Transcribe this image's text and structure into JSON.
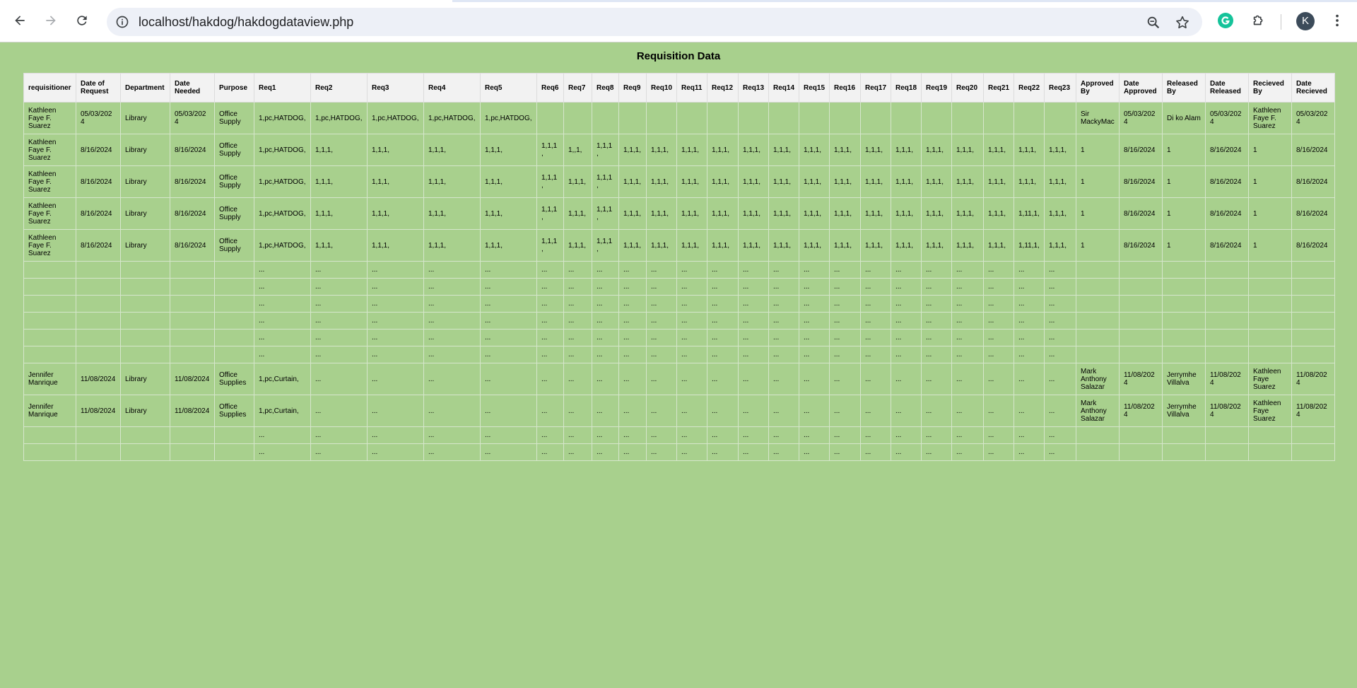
{
  "browser": {
    "url": "localhost/hakdog/hakdogdataview.php",
    "profile_initial": "K"
  },
  "page": {
    "title": "Requisition Data"
  },
  "table": {
    "headers": [
      "requisitioner",
      "Date of Request",
      "Department",
      "Date Needed",
      "Purpose",
      "Req1",
      "Req2",
      "Req3",
      "Req4",
      "Req5",
      "Req6",
      "Req7",
      "Req8",
      "Req9",
      "Req10",
      "Req11",
      "Req12",
      "Req13",
      "Req14",
      "Req15",
      "Req16",
      "Req17",
      "Req18",
      "Req19",
      "Req20",
      "Req21",
      "Req22",
      "Req23",
      "Approved By",
      "Date Approved",
      "Released By",
      "Date Released",
      "Recieved By",
      "Date Recieved"
    ],
    "rows": [
      [
        "Kathleen Faye F. Suarez",
        "05/03/2024",
        "Library",
        "05/03/2024",
        "Office Supply",
        "1,pc,HATDOG,",
        "1,pc,HATDOG,",
        "1,pc,HATDOG,",
        "1,pc,HATDOG,",
        "1,pc,HATDOG,",
        "",
        "",
        "",
        "",
        "",
        "",
        "",
        "",
        "",
        "",
        "",
        "",
        "",
        "",
        "",
        "",
        "",
        "",
        "Sir MackyMac",
        "05/03/2024",
        "Di ko Alam",
        "05/03/2024",
        "Kathleen Faye F. Suarez",
        "05/03/2024"
      ],
      [
        "Kathleen Faye F. Suarez",
        "8/16/2024",
        "Library",
        "8/16/2024",
        "Office Supply",
        "1,pc,HATDOG,",
        "1,1,1,",
        "1,1,1,",
        "1,1,1,",
        "1,1,1,",
        "1,1,1,",
        "1,,1,",
        "1,1,1,",
        "1,1,1,",
        "1,1,1,",
        "1,1,1,",
        "1,1,1,",
        "1,1,1,",
        "1,1,1,",
        "1,1,1,",
        "1,1,1,",
        "1,1,1,",
        "1,1,1,",
        "1,1,1,",
        "1,1,1,",
        "1,1,1,",
        "1,1,1,",
        "1,1,1,",
        "1",
        "8/16/2024",
        "1",
        "8/16/2024",
        "1",
        "8/16/2024"
      ],
      [
        "Kathleen Faye F. Suarez",
        "8/16/2024",
        "Library",
        "8/16/2024",
        "Office Supply",
        "1,pc,HATDOG,",
        "1,1,1,",
        "1,1,1,",
        "1,1,1,",
        "1,1,1,",
        "1,1,1,",
        "1,1,1,",
        "1,1,1,",
        "1,1,1,",
        "1,1,1,",
        "1,1,1,",
        "1,1,1,",
        "1,1,1,",
        "1,1,1,",
        "1,1,1,",
        "1,1,1,",
        "1,1,1,",
        "1,1,1,",
        "1,1,1,",
        "1,1,1,",
        "1,1,1,",
        "1,1,1,",
        "1,1,1,",
        "1",
        "8/16/2024",
        "1",
        "8/16/2024",
        "1",
        "8/16/2024"
      ],
      [
        "Kathleen Faye F. Suarez",
        "8/16/2024",
        "Library",
        "8/16/2024",
        "Office Supply",
        "1,pc,HATDOG,",
        "1,1,1,",
        "1,1,1,",
        "1,1,1,",
        "1,1,1,",
        "1,1,1,",
        "1,1,1,",
        "1,1,1,",
        "1,1,1,",
        "1,1,1,",
        "1,1,1,",
        "1,1,1,",
        "1,1,1,",
        "1,1,1,",
        "1,1,1,",
        "1,1,1,",
        "1,1,1,",
        "1,1,1,",
        "1,1,1,",
        "1,1,1,",
        "1,1,1,",
        "1,11,1,",
        "1,1,1,",
        "1",
        "8/16/2024",
        "1",
        "8/16/2024",
        "1",
        "8/16/2024"
      ],
      [
        "Kathleen Faye F. Suarez",
        "8/16/2024",
        "Library",
        "8/16/2024",
        "Office Supply",
        "1,pc,HATDOG,",
        "1,1,1,",
        "1,1,1,",
        "1,1,1,",
        "1,1,1,",
        "1,1,1,",
        "1,1,1,",
        "1,1,1,",
        "1,1,1,",
        "1,1,1,",
        "1,1,1,",
        "1,1,1,",
        "1,1,1,",
        "1,1,1,",
        "1,1,1,",
        "1,1,1,",
        "1,1,1,",
        "1,1,1,",
        "1,1,1,",
        "1,1,1,",
        "1,1,1,",
        "1,11,1,",
        "1,1,1,",
        "1",
        "8/16/2024",
        "1",
        "8/16/2024",
        "1",
        "8/16/2024"
      ],
      [
        "",
        "",
        "",
        "",
        "",
        "...",
        "...",
        "...",
        "...",
        "...",
        "...",
        "...",
        "...",
        "...",
        "...",
        "...",
        "...",
        "...",
        "...",
        "...",
        "...",
        "...",
        "...",
        "...",
        "...",
        "...",
        "...",
        "...",
        "",
        "",
        "",
        "",
        "",
        ""
      ],
      [
        "",
        "",
        "",
        "",
        "",
        "...",
        "...",
        "...",
        "...",
        "...",
        "...",
        "...",
        "...",
        "...",
        "...",
        "...",
        "...",
        "...",
        "...",
        "...",
        "...",
        "...",
        "...",
        "...",
        "...",
        "...",
        "...",
        "...",
        "",
        "",
        "",
        "",
        "",
        ""
      ],
      [
        "",
        "",
        "",
        "",
        "",
        "...",
        "...",
        "...",
        "...",
        "...",
        "...",
        "...",
        "...",
        "...",
        "...",
        "...",
        "...",
        "...",
        "...",
        "...",
        "...",
        "...",
        "...",
        "...",
        "...",
        "...",
        "...",
        "...",
        "",
        "",
        "",
        "",
        "",
        ""
      ],
      [
        "",
        "",
        "",
        "",
        "",
        "...",
        "...",
        "...",
        "...",
        "...",
        "...",
        "...",
        "...",
        "...",
        "...",
        "...",
        "...",
        "...",
        "...",
        "...",
        "...",
        "...",
        "...",
        "...",
        "...",
        "...",
        "...",
        "...",
        "",
        "",
        "",
        "",
        "",
        ""
      ],
      [
        "",
        "",
        "",
        "",
        "",
        "...",
        "...",
        "...",
        "...",
        "...",
        "...",
        "...",
        "...",
        "...",
        "...",
        "...",
        "...",
        "...",
        "...",
        "...",
        "...",
        "...",
        "...",
        "...",
        "...",
        "...",
        "...",
        "...",
        "",
        "",
        "",
        "",
        "",
        ""
      ],
      [
        "",
        "",
        "",
        "",
        "",
        "...",
        "...",
        "...",
        "...",
        "...",
        "...",
        "...",
        "...",
        "...",
        "...",
        "...",
        "...",
        "...",
        "...",
        "...",
        "...",
        "...",
        "...",
        "...",
        "...",
        "...",
        "...",
        "...",
        "",
        "",
        "",
        "",
        "",
        ""
      ],
      [
        "Jennifer Manrique",
        "11/08/2024",
        "Library",
        "11/08/2024",
        "Office Supplies",
        "1,pc,Curtain,",
        "...",
        "...",
        "...",
        "...",
        "...",
        "...",
        "...",
        "...",
        "...",
        "...",
        "...",
        "...",
        "...",
        "...",
        "...",
        "...",
        "...",
        "...",
        "...",
        "...",
        "...",
        "...",
        "Mark Anthony Salazar",
        "11/08/2024",
        "Jerrymhe Villalva",
        "11/08/2024",
        "Kathleen Faye Suarez",
        "11/08/2024"
      ],
      [
        "Jennifer Manrique",
        "11/08/2024",
        "Library",
        "11/08/2024",
        "Office Supplies",
        "1,pc,Curtain,",
        "...",
        "...",
        "...",
        "...",
        "...",
        "...",
        "...",
        "...",
        "...",
        "...",
        "...",
        "...",
        "...",
        "...",
        "...",
        "...",
        "...",
        "...",
        "...",
        "...",
        "...",
        "...",
        "Mark Anthony Salazar",
        "11/08/2024",
        "Jerrymhe Villalva",
        "11/08/2024",
        "Kathleen Faye Suarez",
        "11/08/2024"
      ],
      [
        "",
        "",
        "",
        "",
        "",
        "...",
        "...",
        "...",
        "...",
        "...",
        "...",
        "...",
        "...",
        "...",
        "...",
        "...",
        "...",
        "...",
        "...",
        "...",
        "...",
        "...",
        "...",
        "...",
        "...",
        "...",
        "...",
        "...",
        "",
        "",
        "",
        "",
        "",
        ""
      ],
      [
        "",
        "",
        "",
        "",
        "",
        "...",
        "...",
        "...",
        "...",
        "...",
        "...",
        "...",
        "...",
        "...",
        "...",
        "...",
        "...",
        "...",
        "...",
        "...",
        "...",
        "...",
        "...",
        "...",
        "...",
        "...",
        "...",
        "...",
        "",
        "",
        "",
        "",
        "",
        ""
      ]
    ]
  }
}
